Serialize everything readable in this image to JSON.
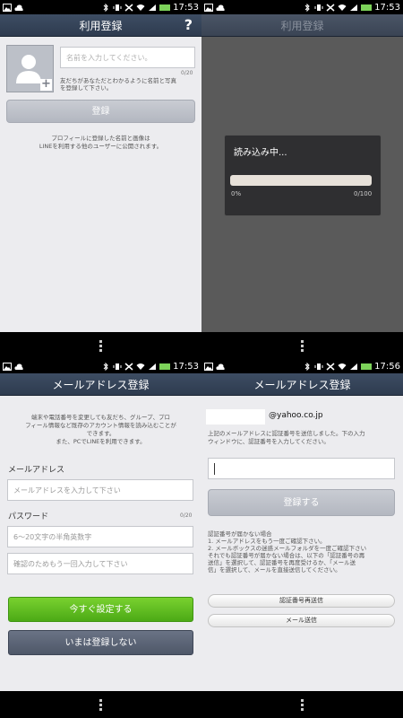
{
  "status": {
    "times": [
      "17:53",
      "17:53",
      "17:53",
      "17:56"
    ]
  },
  "screen1": {
    "title": "利用登録",
    "help": "?",
    "name_placeholder": "名前を入力してください。",
    "counter": "0/20",
    "hint_lines": [
      "友だちがあなただとわかるように名前と写真",
      "を登録して下さい。"
    ],
    "register_button": "登録",
    "note_lines": [
      "プロフィールに登録した名前と画像は",
      "LINEを利用する他のユーザーに公開されます。"
    ]
  },
  "screen2": {
    "title": "利用登録",
    "dialog_title": "読み込み中...",
    "progress_left": "0%",
    "progress_right": "0/100",
    "progress_value": 0
  },
  "screen3": {
    "title": "メールアドレス登録",
    "intro_lines": [
      "端末や電話番号を変更しても友だち、グループ、プロ",
      "フィール情報など既存のアカウント情報を読み込むことが",
      "できます。",
      "また、PCでLINEを利用できます。"
    ],
    "email_label": "メールアドレス",
    "email_placeholder": "メールアドレスを入力して下さい",
    "password_label": "パスワード",
    "password_counter": "0/20",
    "password_placeholder": "6〜20文字の半角英数字",
    "confirm_placeholder": "確認のためもう一回入力して下さい",
    "set_now_button": "今すぐ設定する",
    "skip_button": "いまは登録しない"
  },
  "screen4": {
    "title": "メールアドレス登録",
    "email_domain": "@yahoo.co.jp",
    "info_lines": [
      "上記のメールアドレスに認証番号を送信しました。下の入力",
      "ウィンドウに、認証番号を入力してください。"
    ],
    "register_button": "登録する",
    "help_lines": [
      "認証番号が届かない場合",
      "1. メールアドレスをもう一度ご確認下さい。",
      "2. メールボックスの迷惑メールフォルダを一度ご確認下さい",
      "それでも認証番号が届かない場合は、以下の「認証番号の再",
      "送信」を選択して、認証番号を再度受けるか、「メール送",
      "信」を選択して、メールを直接送信してください。"
    ],
    "resend_button": "認証番号再送信",
    "send_mail_button": "メール送信"
  }
}
